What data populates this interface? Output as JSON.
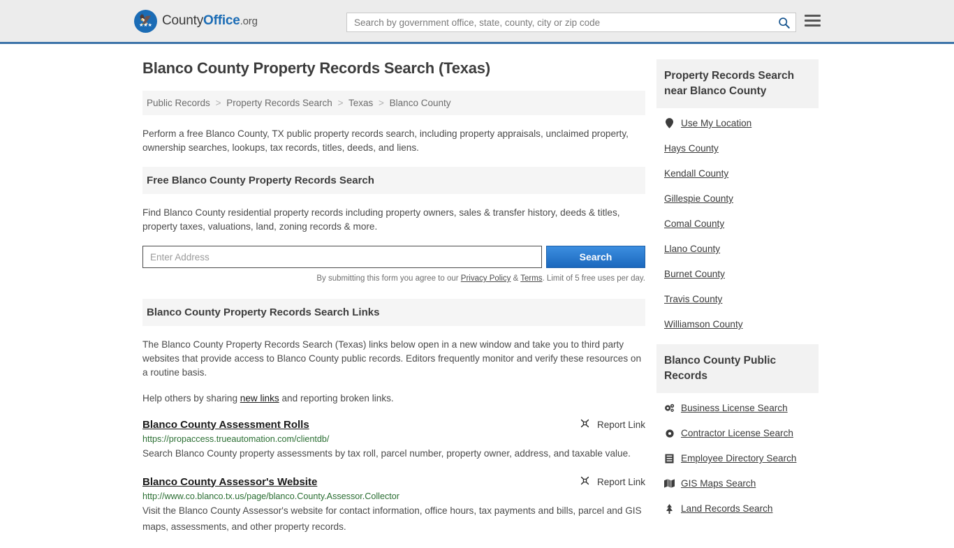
{
  "header": {
    "logo": {
      "part1": "County",
      "part2": "Office",
      "tld": ".org"
    },
    "search": {
      "placeholder": "Search by government office, state, county, city or zip code",
      "value": "",
      "icon": "search-icon"
    },
    "menu_icon": "hamburger-menu-icon"
  },
  "main": {
    "title": "Blanco County Property Records Search (Texas)",
    "breadcrumb": [
      "Public Records",
      "Property Records Search",
      "Texas",
      "Blanco County"
    ],
    "breadcrumb_separator": ">",
    "intro": "Perform a free Blanco County, TX public property records search, including property appraisals, unclaimed property, ownership searches, lookups, tax records, titles, deeds, and liens.",
    "free_search": {
      "heading": "Free Blanco County Property Records Search",
      "description": "Find Blanco County residential property records including property owners, sales & transfer history, deeds & titles, property taxes, valuations, land, zoning records & more.",
      "input_placeholder": "Enter Address",
      "input_value": "",
      "button_label": "Search",
      "disclaimer_prefix": "By submitting this form you agree to our ",
      "privacy_label": "Privacy Policy",
      "disclaimer_amp": " & ",
      "terms_label": "Terms",
      "disclaimer_suffix": ". Limit of 5 free uses per day."
    },
    "links_section": {
      "heading": "Blanco County Property Records Search Links",
      "paragraph": "The Blanco County Property Records Search (Texas) links below open in a new window and take you to third party websites that provide access to Blanco County public records. Editors frequently monitor and verify these resources on a routine basis.",
      "help_prefix": "Help others by sharing ",
      "help_link": "new links",
      "help_suffix": " and reporting broken links.",
      "report_label": "Report Link",
      "report_icon": "broken-link-icon",
      "results": [
        {
          "title": "Blanco County Assessment Rolls",
          "url": "https://propaccess.trueautomation.com/clientdb/",
          "description": "Search Blanco County property assessments by tax roll, parcel number, property owner, address, and taxable value."
        },
        {
          "title": "Blanco County Assessor's Website",
          "url": "http://www.co.blanco.tx.us/page/blanco.County.Assessor.Collector",
          "description": "Visit the Blanco County Assessor's website for contact information, office hours, tax payments and bills, parcel and GIS maps, assessments, and other property records."
        }
      ]
    }
  },
  "sidebar": {
    "nearby": {
      "heading": "Property Records Search near Blanco County",
      "items": [
        {
          "label": "Use My Location",
          "icon": "map-pin-icon"
        },
        {
          "label": "Hays County",
          "icon": ""
        },
        {
          "label": "Kendall County",
          "icon": ""
        },
        {
          "label": "Gillespie County",
          "icon": ""
        },
        {
          "label": "Comal County",
          "icon": ""
        },
        {
          "label": "Llano County",
          "icon": ""
        },
        {
          "label": "Burnet County",
          "icon": ""
        },
        {
          "label": "Travis County",
          "icon": ""
        },
        {
          "label": "Williamson County",
          "icon": ""
        }
      ]
    },
    "public_records": {
      "heading": "Blanco County Public Records",
      "items": [
        {
          "label": "Business License Search",
          "icon": "gears-icon",
          "glyph": "⚙"
        },
        {
          "label": "Contractor License Search",
          "icon": "gear-icon",
          "glyph": "⚙"
        },
        {
          "label": "Employee Directory Search",
          "icon": "book-icon",
          "glyph": "▤"
        },
        {
          "label": "GIS Maps Search",
          "icon": "map-icon",
          "glyph": "▥"
        },
        {
          "label": "Land Records Search",
          "icon": "tree-icon",
          "glyph": "♣"
        }
      ]
    }
  },
  "colors": {
    "accent_blue": "#1b6cb5",
    "header_border": "#3b73a8",
    "url_green": "#2a6e32",
    "panel_gray": "#f5f5f5"
  }
}
